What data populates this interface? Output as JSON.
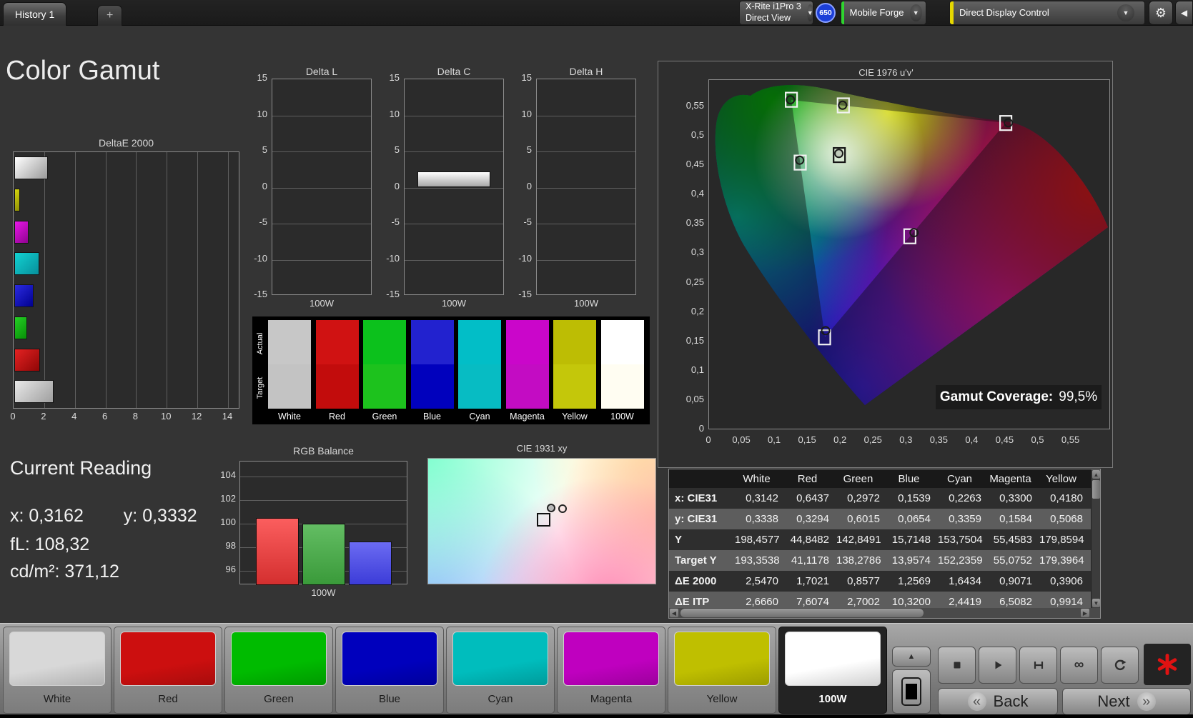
{
  "app": {
    "title": "Color Gamut"
  },
  "top_bar": {
    "tab_label": "History 1",
    "new_tab_label": "+",
    "meter_line1": "X-Rite i1Pro 3",
    "meter_line2": "Direct View",
    "badge": "650",
    "source_label": "Mobile Forge",
    "control_label": "Direct Display Control",
    "accent_green": "#2fd42f",
    "accent_yellow": "#e6d800",
    "icons": {
      "gear": "⚙",
      "collapse": "◀",
      "caret": "▼"
    }
  },
  "chart_data": [
    {
      "type": "bar",
      "orientation": "horizontal",
      "title": "DeltaE 2000",
      "categories": [
        "100W",
        "Yellow",
        "Magenta",
        "Cyan",
        "Blue",
        "Green",
        "Red",
        "White"
      ],
      "values": [
        2.2,
        0.39,
        0.91,
        1.64,
        1.26,
        0.86,
        1.7,
        2.55
      ],
      "bar_colors": [
        [
          "#ffffff",
          "#9a9a9a"
        ],
        [
          "#d6d60e",
          "#8f8f06"
        ],
        [
          "#e816e8",
          "#900390"
        ],
        [
          "#12d2d2",
          "#078f9b"
        ],
        [
          "#2b2be0",
          "#00008f"
        ],
        [
          "#25cf25",
          "#078f07"
        ],
        [
          "#e42222",
          "#8f0606"
        ],
        [
          "#e8e8e8",
          "#9f9f9f"
        ]
      ],
      "xlim": [
        0,
        14.7
      ],
      "x_ticks": [
        "0",
        "2",
        "4",
        "6",
        "8",
        "10",
        "12",
        "14"
      ]
    },
    {
      "type": "bar",
      "titles": [
        "Delta L",
        "Delta C",
        "Delta H"
      ],
      "values": [
        0,
        2.2,
        0
      ],
      "ylim": [
        -15,
        15
      ],
      "y_ticks": [
        "15",
        "10",
        "5",
        "0",
        "-5",
        "-10",
        "-15"
      ],
      "xlabel": "100W"
    },
    {
      "type": "scatter",
      "title": "CIE 1976 u'v'",
      "x_ticks": [
        "0",
        "0,05",
        "0,1",
        "0,15",
        "0,2",
        "0,25",
        "0,3",
        "0,35",
        "0,4",
        "0,45",
        "0,5",
        "0,55"
      ],
      "y_ticks": [
        "0",
        "0,05",
        "0,1",
        "0,15",
        "0,2",
        "0,25",
        "0,3",
        "0,35",
        "0,4",
        "0,45",
        "0,5",
        "0,55"
      ],
      "coverage_label": "Gamut Coverage:",
      "coverage_value": "99,5%",
      "points": [
        {
          "name": "White",
          "marker": "dark",
          "target": [
            0.1978,
            0.4683
          ],
          "actual": [
            0.1971,
            0.4711
          ]
        },
        {
          "name": "Red",
          "marker": "light",
          "target": [
            0.4507,
            0.5229
          ],
          "actual": [
            0.4545,
            0.5233
          ]
        },
        {
          "name": "Green",
          "marker": "light",
          "target": [
            0.125,
            0.5625
          ],
          "actual": [
            0.1235,
            0.5625
          ]
        },
        {
          "name": "Blue",
          "marker": "light",
          "target": [
            0.1754,
            0.1579
          ],
          "actual": [
            0.177,
            0.1693
          ]
        },
        {
          "name": "Cyan",
          "marker": "light",
          "target": [
            0.1384,
            0.4555
          ],
          "actual": [
            0.1376,
            0.4596
          ]
        },
        {
          "name": "Magenta",
          "marker": "light",
          "target": [
            0.305,
            0.33
          ],
          "actual": [
            0.3113,
            0.3362
          ]
        },
        {
          "name": "Yellow",
          "marker": "light",
          "target": [
            0.2039,
            0.5529
          ],
          "actual": [
            0.2028,
            0.5532
          ]
        }
      ]
    },
    {
      "type": "bar",
      "title": "RGB Balance",
      "categories": [
        "Red",
        "Green",
        "Blue"
      ],
      "values": [
        100.5,
        100.0,
        98.5
      ],
      "bar_colors": [
        [
          "#fb5e5e",
          "#d42f2f"
        ],
        [
          "#63bd63",
          "#3a9a3a"
        ],
        [
          "#6b6bf2",
          "#3c3cd8"
        ]
      ],
      "ylim": [
        94.8,
        105.3
      ],
      "y_ticks": [
        "104",
        "102",
        "100",
        "98",
        "96"
      ],
      "xlabel": "100W"
    },
    {
      "type": "scatter",
      "title": "CIE 1931 xy"
    }
  ],
  "swatch_strip": {
    "row_labels": [
      "Actual",
      "Target"
    ],
    "columns": [
      {
        "label": "White",
        "actual": "#c7c7c7",
        "target": "#c3c3c3"
      },
      {
        "label": "Red",
        "actual": "#d01212",
        "target": "#c20c0c"
      },
      {
        "label": "Green",
        "actual": "#0cc11c",
        "target": "#1dc21d"
      },
      {
        "label": "Blue",
        "actual": "#2222cf",
        "target": "#0101bd"
      },
      {
        "label": "Cyan",
        "actual": "#02bec7",
        "target": "#07bcc3"
      },
      {
        "label": "Magenta",
        "actual": "#ca06ca",
        "target": "#c30cc3"
      },
      {
        "label": "Yellow",
        "actual": "#bdbd04",
        "target": "#c4c70a"
      },
      {
        "label": "100W",
        "actual": "#ffffff",
        "target": "#fffdf2"
      }
    ]
  },
  "current_reading": {
    "title": "Current Reading",
    "x_label": "x:",
    "x_value": "0,3162",
    "y_label": "y:",
    "y_value": "0,3332",
    "fl_label": "fL:",
    "fl_value": "108,32",
    "cd_label": "cd/m²:",
    "cd_value": "371,12"
  },
  "table": {
    "headers": [
      "White",
      "Red",
      "Green",
      "Blue",
      "Cyan",
      "Magenta",
      "Yellow"
    ],
    "rows": [
      {
        "label": "x: CIE31",
        "values": [
          "0,3142",
          "0,6437",
          "0,2972",
          "0,1539",
          "0,2263",
          "0,3300",
          "0,4180"
        ]
      },
      {
        "label": "y: CIE31",
        "values": [
          "0,3338",
          "0,3294",
          "0,6015",
          "0,0654",
          "0,3359",
          "0,1584",
          "0,5068"
        ]
      },
      {
        "label": "Y",
        "values": [
          "198,4577",
          "44,8482",
          "142,8491",
          "15,7148",
          "153,7504",
          "55,4583",
          "179,8594"
        ]
      },
      {
        "label": "Target Y",
        "values": [
          "193,3538",
          "41,1178",
          "138,2786",
          "13,9574",
          "152,2359",
          "55,0752",
          "179,3964"
        ]
      },
      {
        "label": "ΔE 2000",
        "values": [
          "2,5470",
          "1,7021",
          "0,8577",
          "1,2569",
          "1,6434",
          "0,9071",
          "0,3906"
        ]
      },
      {
        "label": "ΔE ITP",
        "values": [
          "2,6660",
          "7,6074",
          "2,7002",
          "10,3200",
          "2,4419",
          "6,5082",
          "0,9914"
        ]
      }
    ]
  },
  "bottom_bar": {
    "patches": [
      {
        "label": "White",
        "color": "#d8d8d8",
        "selected": false
      },
      {
        "label": "Red",
        "color": "#cc0f0f",
        "selected": false
      },
      {
        "label": "Green",
        "color": "#00bb00",
        "selected": false
      },
      {
        "label": "Blue",
        "color": "#0000bd",
        "selected": false
      },
      {
        "label": "Cyan",
        "color": "#00bdbd",
        "selected": false
      },
      {
        "label": "Magenta",
        "color": "#bf00bf",
        "selected": false
      },
      {
        "label": "Yellow",
        "color": "#bfbf00",
        "selected": false
      },
      {
        "label": "100W",
        "color": "#ffffff",
        "selected": true
      }
    ],
    "transport": [
      "stop",
      "play",
      "single",
      "infinity",
      "loop"
    ],
    "icons": {
      "up": "▲",
      "stop": "■",
      "play": "▶",
      "infinity": "∞",
      "back_chevron": "«",
      "next_chevron": "»"
    },
    "asterisk_color": "#e01212",
    "back_label": "Back",
    "next_label": "Next"
  }
}
